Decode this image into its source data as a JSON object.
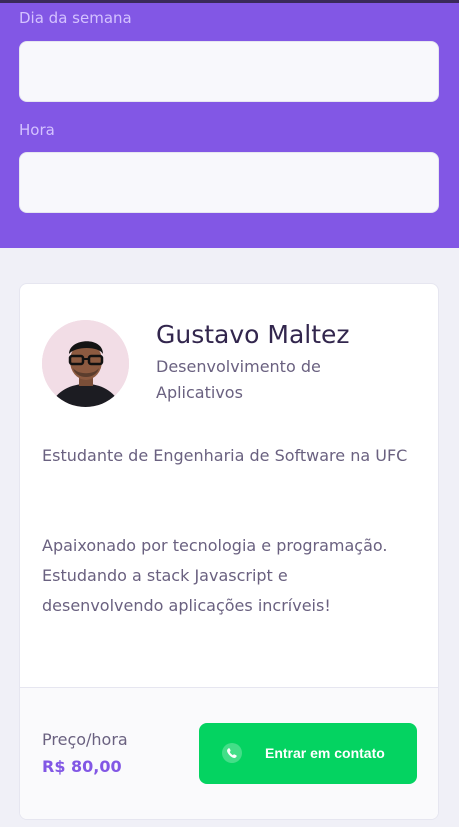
{
  "filters": {
    "weekday_label": "Dia da semana",
    "weekday_value": "",
    "time_label": "Hora",
    "time_value": ""
  },
  "teacher": {
    "name": "Gustavo Maltez",
    "subject": "Desenvolvimento de Aplicativos",
    "bio_line1": "Estudante de Engenharia de Software na UFC",
    "bio_line2": "Apaixonado por tecnologia e programação. Estudando a stack Javascript e desenvolvendo aplicações incríveis!",
    "price_label": "Preço/hora",
    "price_value": "R$ 80,00",
    "contact_label": "Entrar em contato"
  },
  "colors": {
    "primary": "#8257e5",
    "secondary": "#04d361",
    "background": "#f0f0f7"
  },
  "icons": {
    "contact": "whatsapp-icon",
    "avatar": "avatar"
  }
}
